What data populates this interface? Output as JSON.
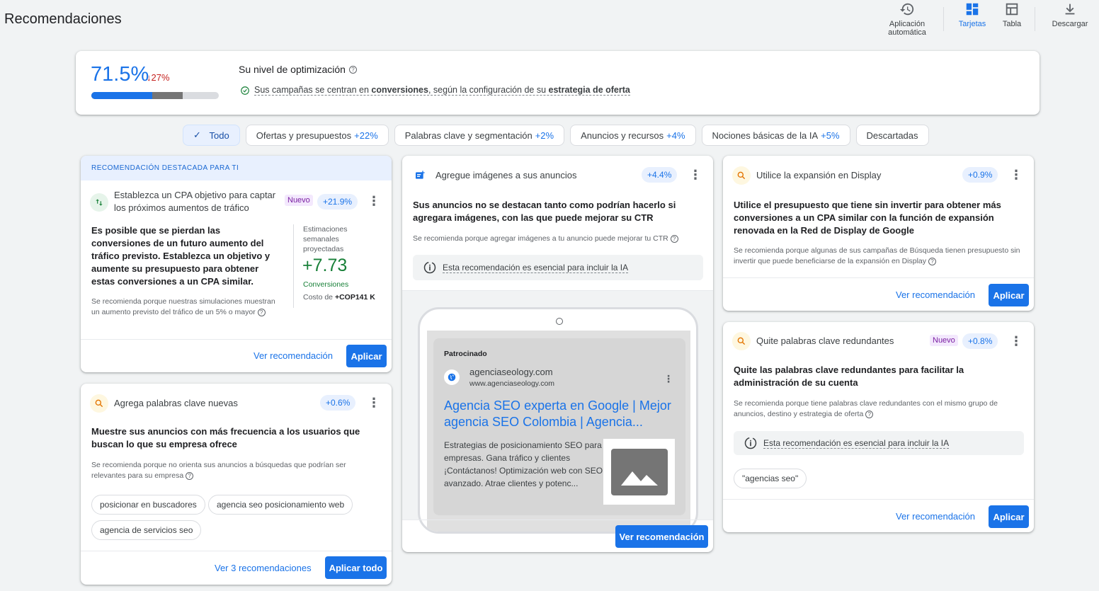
{
  "page": {
    "title": "Recomendaciones"
  },
  "toolbar": {
    "auto_apply_line1": "Aplicación",
    "auto_apply_line2": "automática",
    "cards": "Tarjetas",
    "table": "Tabla",
    "download": "Descargar"
  },
  "optimization": {
    "score": "71.5%",
    "delta": "27%",
    "bar_fill_primary": 0.48,
    "bar_fill_secondary": 0.715,
    "title": "Su nivel de optimización",
    "sub_pre": "Sus campañas se centran en ",
    "sub_b1": "conversiones",
    "sub_mid": ", según la configuración de su ",
    "sub_b2": "estrategia de oferta"
  },
  "filters": [
    {
      "label": "Todo",
      "pct": "",
      "selected": true
    },
    {
      "label": "Ofertas y presupuestos",
      "pct": "+22%"
    },
    {
      "label": "Palabras clave y segmentación",
      "pct": "+2%"
    },
    {
      "label": "Anuncios y recursos",
      "pct": "+4%"
    },
    {
      "label": "Nociones básicas de la IA",
      "pct": "+5%"
    },
    {
      "label": "Descartadas",
      "pct": ""
    }
  ],
  "featured": {
    "banner": "RECOMENDACIÓN DESTACADA PARA TI",
    "title": "Establezca un CPA objetivo para captar los próximos aumentos de tráfico",
    "badge_new": "Nuevo",
    "badge_pct": "+21.9%",
    "body": "Es posible que se pierdan las conversiones de un futuro aumento del tráfico previsto. Establezca un objetivo y aumente su presupuesto para obtener estas conversiones a un CPA similar.",
    "reason": "Se recomienda porque nuestras simulaciones muestran un aumento previsto del tráfico de un 5% o mayor",
    "est_label": "Estimaciones semanales proyectadas",
    "est_value": "+7.73",
    "est_unit": "Conversiones",
    "cost_label": "Costo de ",
    "cost_value": "+COP141 K",
    "view": "Ver recomendación",
    "apply": "Aplicar"
  },
  "keywords_card": {
    "title": "Agrega palabras clave nuevas",
    "badge_pct": "+0.6%",
    "body": "Muestre sus anuncios con más frecuencia a los usuarios que buscan lo que su empresa ofrece",
    "reason": "Se recomienda porque no orienta sus anuncios a búsquedas que podrían ser relevantes para su empresa",
    "keywords": [
      "posicionar en buscadores",
      "agencia seo posicionamiento web",
      "agencia de servicios seo"
    ],
    "view": "Ver 3 recomendaciones",
    "apply": "Aplicar todo"
  },
  "images_card": {
    "title": "Agregue imágenes a sus anuncios",
    "badge_pct": "+4.4%",
    "body": "Sus anuncios no se destacan tanto como podrían hacerlo si agregara imágenes, con las que puede mejorar su CTR",
    "reason": "Se recomienda porque agregar imágenes a tu anuncio puede mejorar tu CTR",
    "ai_note": "Esta recomendación es esencial para incluir la IA",
    "ad_sponsored": "Patrocinado",
    "ad_site": "agenciaseology.com",
    "ad_url": "www.agenciaseology.com",
    "ad_headline": "Agencia SEO experta en Google | Mejor agencia SEO Colombia | Agencia...",
    "ad_desc": "Estrategias de posicionamiento SEO para empresas. Gana tráfico y clientes ¡Contáctanos! Optimización web con SEO avanzado. Atrae clientes y potenc...",
    "view": "Ver recomendación"
  },
  "display_card": {
    "title": "Utilice la expansión en Display",
    "badge_pct": "+0.9%",
    "body": "Utilice el presupuesto que tiene sin invertir para obtener más conversiones a un CPA similar con la función de expansión renovada en la Red de Display de Google",
    "reason": "Se recomienda porque algunas de sus campañas de Búsqueda tienen presupuesto sin invertir que puede beneficiarse de la expansión en Display",
    "view": "Ver recomendación",
    "apply": "Aplicar"
  },
  "redundant_card": {
    "title": "Quite palabras clave redundantes",
    "badge_new": "Nuevo",
    "badge_pct": "+0.8%",
    "body": "Quite las palabras clave redundantes para facilitar la administración de su cuenta",
    "reason": "Se recomienda porque tiene palabras clave redundantes con el mismo grupo de anuncios, destino y estrategia de oferta",
    "ai_note": "Esta recomendación es esencial para incluir la IA",
    "keyword": "\"agencias seo\"",
    "view": "Ver recomendación",
    "apply": "Aplicar"
  },
  "colors": {
    "accent": "#1a73e8",
    "danger": "#c5221f",
    "success": "#188038",
    "new_badge": "#7b1fa2"
  }
}
